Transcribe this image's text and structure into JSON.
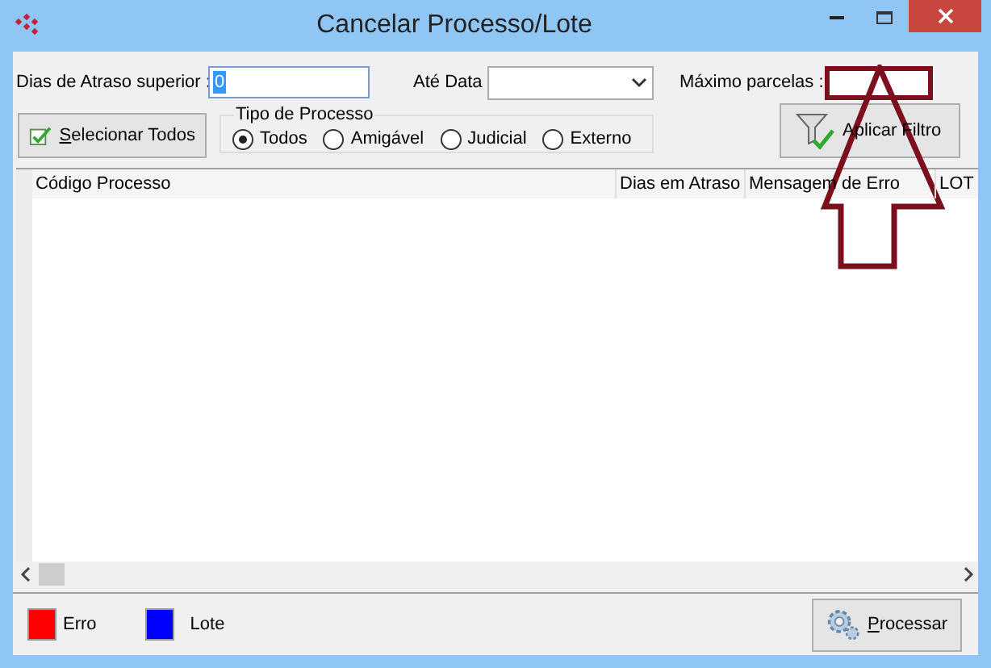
{
  "window": {
    "title": "Cancelar Processo/Lote"
  },
  "filters": {
    "dias_label": "Dias de Atraso superior :",
    "dias_value": "0",
    "ate_data_label": "Até Data",
    "maximo_label": "Máximo parcelas :"
  },
  "select_all_button": "Selecionar Todos",
  "tipo_processo": {
    "title": "Tipo de Processo",
    "options": [
      {
        "label": "Todos",
        "selected": true
      },
      {
        "label": "Amigável",
        "selected": false
      },
      {
        "label": "Judicial",
        "selected": false
      },
      {
        "label": "Externo",
        "selected": false
      }
    ]
  },
  "apply_button": "Aplicar Filtro",
  "table": {
    "columns": [
      "Código Processo",
      "Dias em Atraso",
      "Mensagem de Erro",
      "LOT"
    ]
  },
  "legend": [
    {
      "label": "Erro",
      "color": "#ff0000"
    },
    {
      "label": "Lote",
      "color": "#0000ff"
    }
  ],
  "process_button": "Processar"
}
